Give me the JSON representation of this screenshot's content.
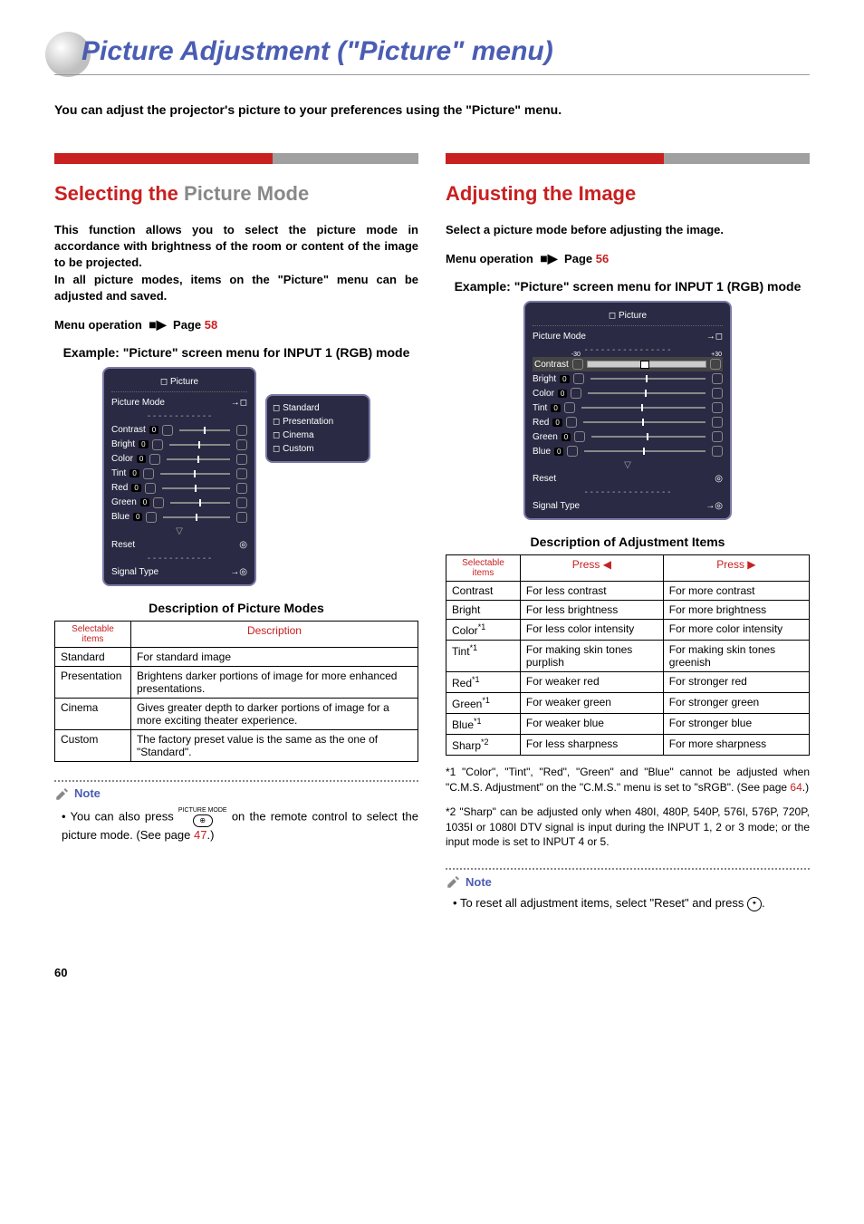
{
  "page_title": "Picture Adjustment (\"Picture\" menu)",
  "intro": "You can adjust the projector's picture to your preferences using the \"Picture\" menu.",
  "left": {
    "section_title_a": "Selecting the ",
    "section_title_b": "Picture Mode",
    "body": "This function allows you to select the picture mode in accordance with brightness of the room or content of the image to be projected.\nIn all picture modes, items on the \"Picture\" menu can be adjusted and saved.",
    "menu_op": "Menu operation",
    "menu_op_page_label": "Page",
    "menu_op_page": "58",
    "example_caption": "Example: \"Picture\" screen menu for INPUT 1 (RGB) mode",
    "osd_header": "Picture",
    "osd_picture_mode": "Picture Mode",
    "sliders": [
      "Contrast",
      "Bright",
      "Color",
      "Tint",
      "Red",
      "Green",
      "Blue"
    ],
    "slider_val": "0",
    "osd_reset": "Reset",
    "osd_signal": "Signal Type",
    "mode_options": [
      "Standard",
      "Presentation",
      "Cinema",
      "Custom"
    ],
    "table_caption": "Description of Picture Modes",
    "table_h1": "Selectable items",
    "table_h2": "Description",
    "modes": [
      {
        "name": "Standard",
        "desc": "For standard image"
      },
      {
        "name": "Presentation",
        "desc": "Brightens darker portions of image for more enhanced presentations."
      },
      {
        "name": "Cinema",
        "desc": "Gives greater depth to darker portions of image for a more exciting theater experience."
      },
      {
        "name": "Custom",
        "desc": "The factory preset value is the same as the one of \"Standard\"."
      }
    ],
    "note_label": "Note",
    "note_a": "You can also press ",
    "note_btn_label": "PICTURE MODE",
    "note_b": " on the remote control to select the picture mode. (See page ",
    "note_page": "47",
    "note_c": ".)"
  },
  "right": {
    "section_title": "Adjusting the Image",
    "body": "Select a picture mode before adjusting the image.",
    "menu_op": "Menu operation",
    "menu_op_page_label": "Page",
    "menu_op_page": "56",
    "example_caption": "Example: \"Picture\" screen menu for INPUT 1 (RGB) mode",
    "osd_header": "Picture",
    "osd_picture_mode": "Picture Mode",
    "contrast_label": "Contrast",
    "contrast_min": "-30",
    "contrast_val": "0",
    "contrast_max": "+30",
    "sliders": [
      "Bright",
      "Color",
      "Tint",
      "Red",
      "Green",
      "Blue"
    ],
    "slider_val": "0",
    "osd_reset": "Reset",
    "osd_signal": "Signal Type",
    "table_caption": "Description of Adjustment Items",
    "table_h1": "Selectable items",
    "table_h2": "Press",
    "table_h3": "Press",
    "items": [
      {
        "n": "Contrast",
        "sup": "",
        "l": "For less contrast",
        "r": "For more contrast"
      },
      {
        "n": "Bright",
        "sup": "",
        "l": "For less brightness",
        "r": "For more brightness"
      },
      {
        "n": "Color",
        "sup": "*1",
        "l": "For less color intensity",
        "r": "For more color intensity"
      },
      {
        "n": "Tint",
        "sup": "*1",
        "l": "For making skin tones purplish",
        "r": "For making skin tones greenish"
      },
      {
        "n": "Red",
        "sup": "*1",
        "l": "For weaker red",
        "r": "For stronger red"
      },
      {
        "n": "Green",
        "sup": "*1",
        "l": "For weaker green",
        "r": "For stronger green"
      },
      {
        "n": "Blue",
        "sup": "*1",
        "l": "For weaker blue",
        "r": "For stronger blue"
      },
      {
        "n": "Sharp",
        "sup": "*2",
        "l": "For less sharpness",
        "r": "For more sharpness"
      }
    ],
    "fn1_a": "*1 \"Color\", \"Tint\", \"Red\", \"Green\" and \"Blue\" cannot be adjusted when \"C.M.S. Adjustment\" on the \"C.M.S.\" menu is set to \"sRGB\". (See page ",
    "fn1_page": "64",
    "fn1_b": ".)",
    "fn2": "*2 \"Sharp\" can be adjusted only when 480I, 480P, 540P, 576I, 576P, 720P, 1035I or 1080I DTV signal is input during the INPUT 1, 2 or 3 mode; or the input mode is set to INPUT 4 or 5.",
    "note_label": "Note",
    "note_a": "To reset all adjustment items, select \"Reset\" and press ",
    "note_b": "."
  },
  "page_number": "60"
}
